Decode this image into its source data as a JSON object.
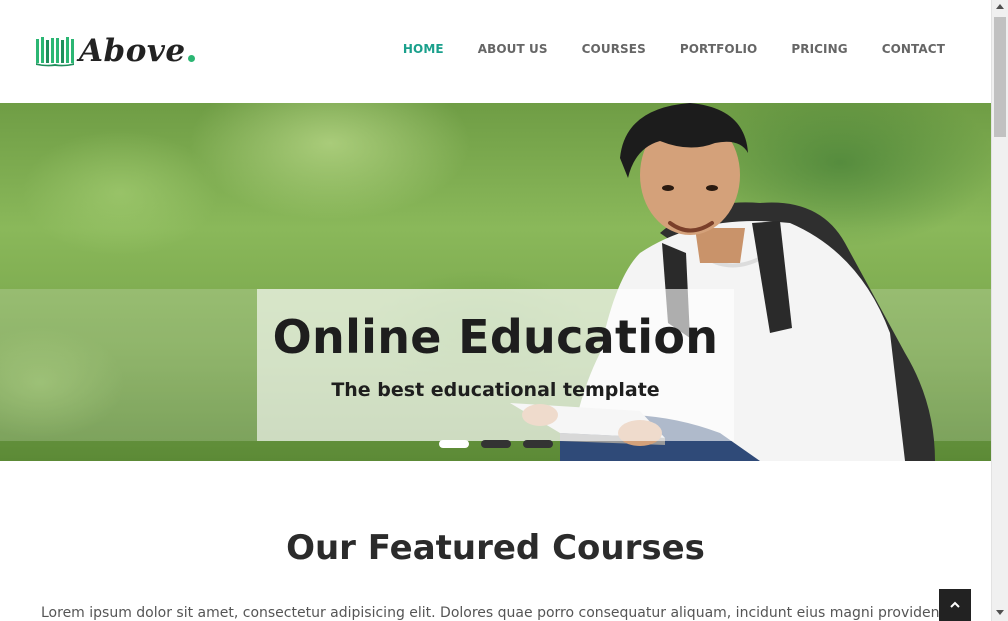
{
  "brand": {
    "name": "Above",
    "accent_color": "#1aa08c",
    "logo_icon": "open-book-icon"
  },
  "nav": {
    "items": [
      {
        "label": "HOME",
        "active": true
      },
      {
        "label": "ABOUT US",
        "active": false
      },
      {
        "label": "COURSES",
        "active": false
      },
      {
        "label": "PORTFOLIO",
        "active": false
      },
      {
        "label": "PRICING",
        "active": false
      },
      {
        "label": "CONTACT",
        "active": false
      }
    ]
  },
  "hero": {
    "title": "Online Education",
    "subtitle": "The best educational template",
    "slide_count": 3,
    "active_slide": 1
  },
  "featured": {
    "title": "Our Featured Courses",
    "description": "Lorem ipsum dolor sit amet, consectetur adipisicing elit. Dolores quae porro consequatur aliquam, incidunt eius magni provident, doloribus"
  },
  "back_to_top": {
    "icon": "chevron-up-icon"
  }
}
